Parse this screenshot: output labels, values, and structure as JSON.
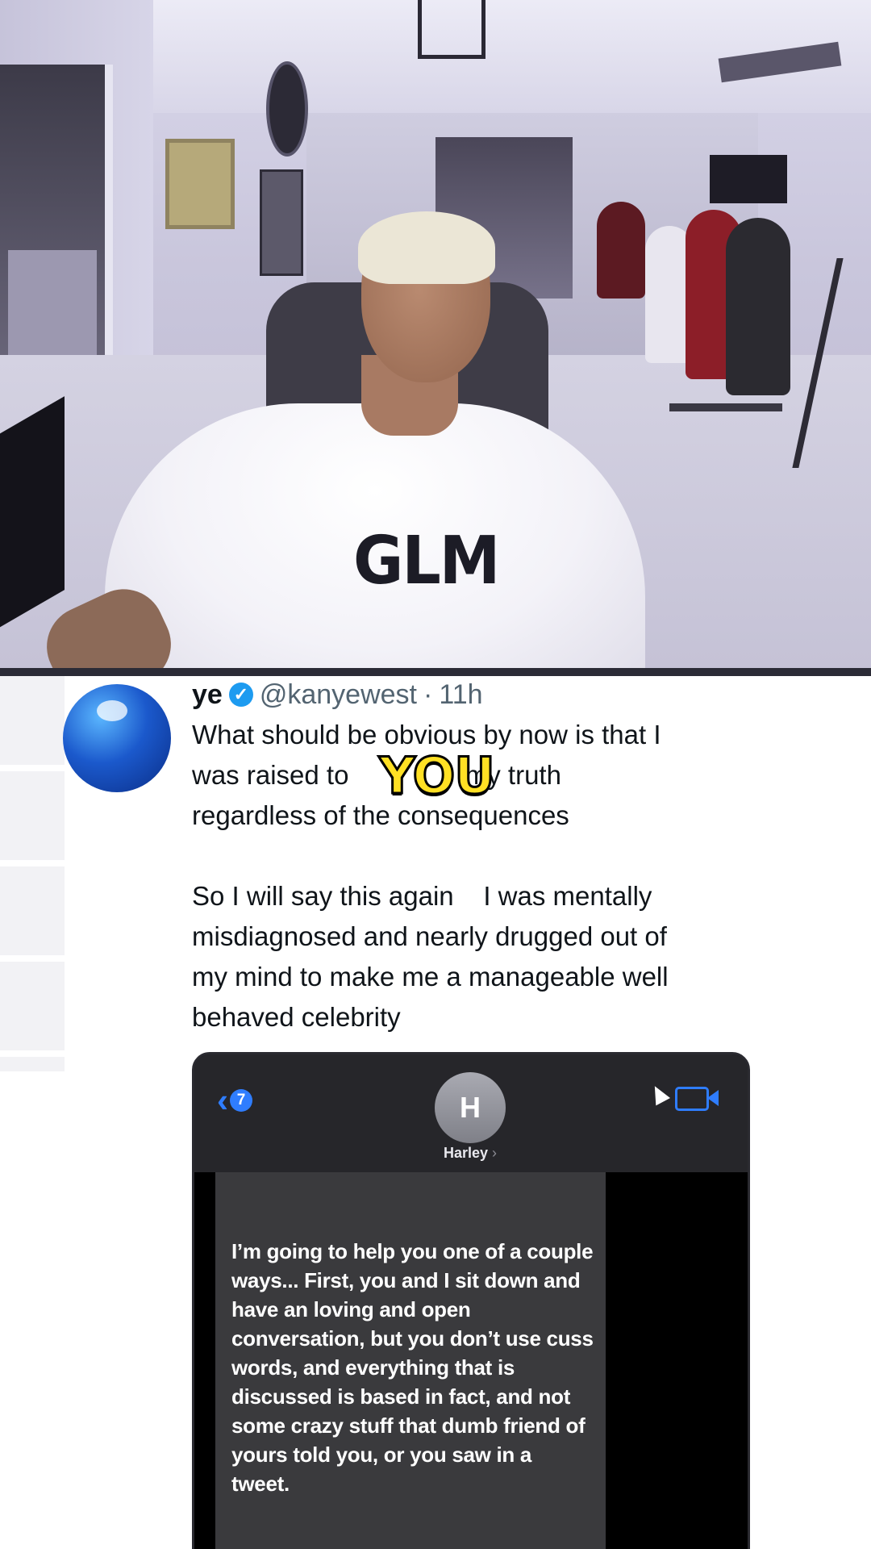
{
  "video": {
    "shirt_text": "GLM"
  },
  "caption": {
    "text": "YOU",
    "color": "#ffe024"
  },
  "tweet": {
    "name": "ye",
    "handle": "@kanyewest",
    "separator": "·",
    "time": "11h",
    "verified_icon": "verified-check-icon",
    "line1": "What should be obvious by now is that I",
    "line2_start": "was raised to ",
    "line2_end": " my truth",
    "line3": "regardless of the consequences",
    "line4": "So I will say this again    I was mentally",
    "line5": "misdiagnosed and nearly drugged out of",
    "line6": "my mind to make me a manageable well",
    "line7": "behaved celebrity"
  },
  "phone": {
    "back_badge": "7",
    "contact_initial": "H",
    "contact_name": "Harley",
    "contact_chevron": "›",
    "message": "I’m going to help you one of a couple ways... First, you and I sit down and have an loving and open  conversation, but you don’t use cuss words, and everything that is discussed is based in fact, and not some crazy stuff that dumb friend of yours told you, or you saw in a tweet.",
    "accent_color": "#2f7dff"
  }
}
